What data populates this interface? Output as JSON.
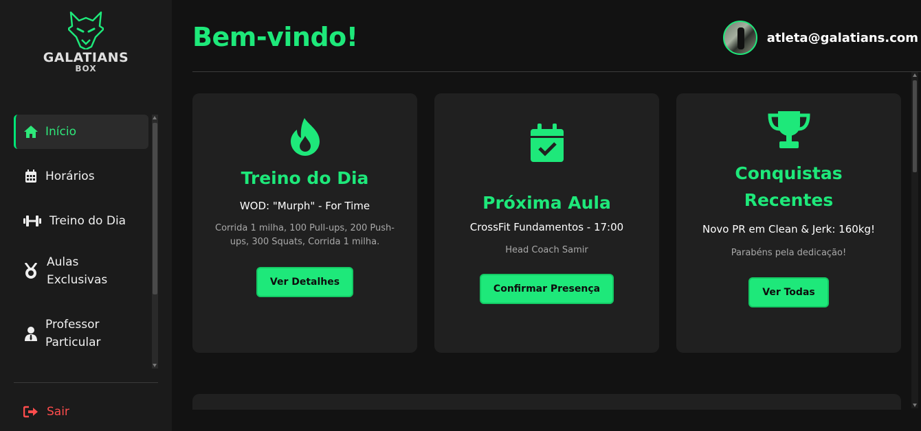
{
  "brand": {
    "name": "GALATIANS",
    "sub": "BOX"
  },
  "nav": {
    "items": [
      {
        "label": "Início",
        "icon": "home-icon",
        "active": true
      },
      {
        "label": "Horários",
        "icon": "calendar-icon"
      },
      {
        "label": "Treino do Dia",
        "icon": "dumbbell-icon"
      },
      {
        "label": "Aulas Exclusivas",
        "icon": "medal-icon"
      },
      {
        "label": "Professor Particular",
        "icon": "user-tie-icon"
      }
    ],
    "logout": "Sair"
  },
  "header": {
    "title": "Bem-vindo!",
    "user_email": "atleta@galatians.com"
  },
  "cards": [
    {
      "icon": "flame-icon",
      "title": "Treino do Dia",
      "subtitle": "WOD: \"Murph\" - For Time",
      "description": "Corrida 1 milha, 100 Pull-ups, 200 Push-ups, 300 Squats, Corrida 1 milha.",
      "button": "Ver Detalhes"
    },
    {
      "icon": "calendar-check-icon",
      "title": "Próxima Aula",
      "subtitle": "CrossFit Fundamentos - 17:00",
      "description": "Head Coach Samir",
      "button": "Confirmar Presença"
    },
    {
      "icon": "trophy-icon",
      "title": "Conquistas Recentes",
      "subtitle": "Novo PR em Clean & Jerk: 160kg!",
      "description": "Parabéns pela dedicação!",
      "button": "Ver Todas"
    }
  ],
  "colors": {
    "accent": "#1ee87a",
    "danger": "#ff4d4d",
    "sidebar": "#1b1b1b",
    "card": "#202020",
    "background": "#121212"
  }
}
